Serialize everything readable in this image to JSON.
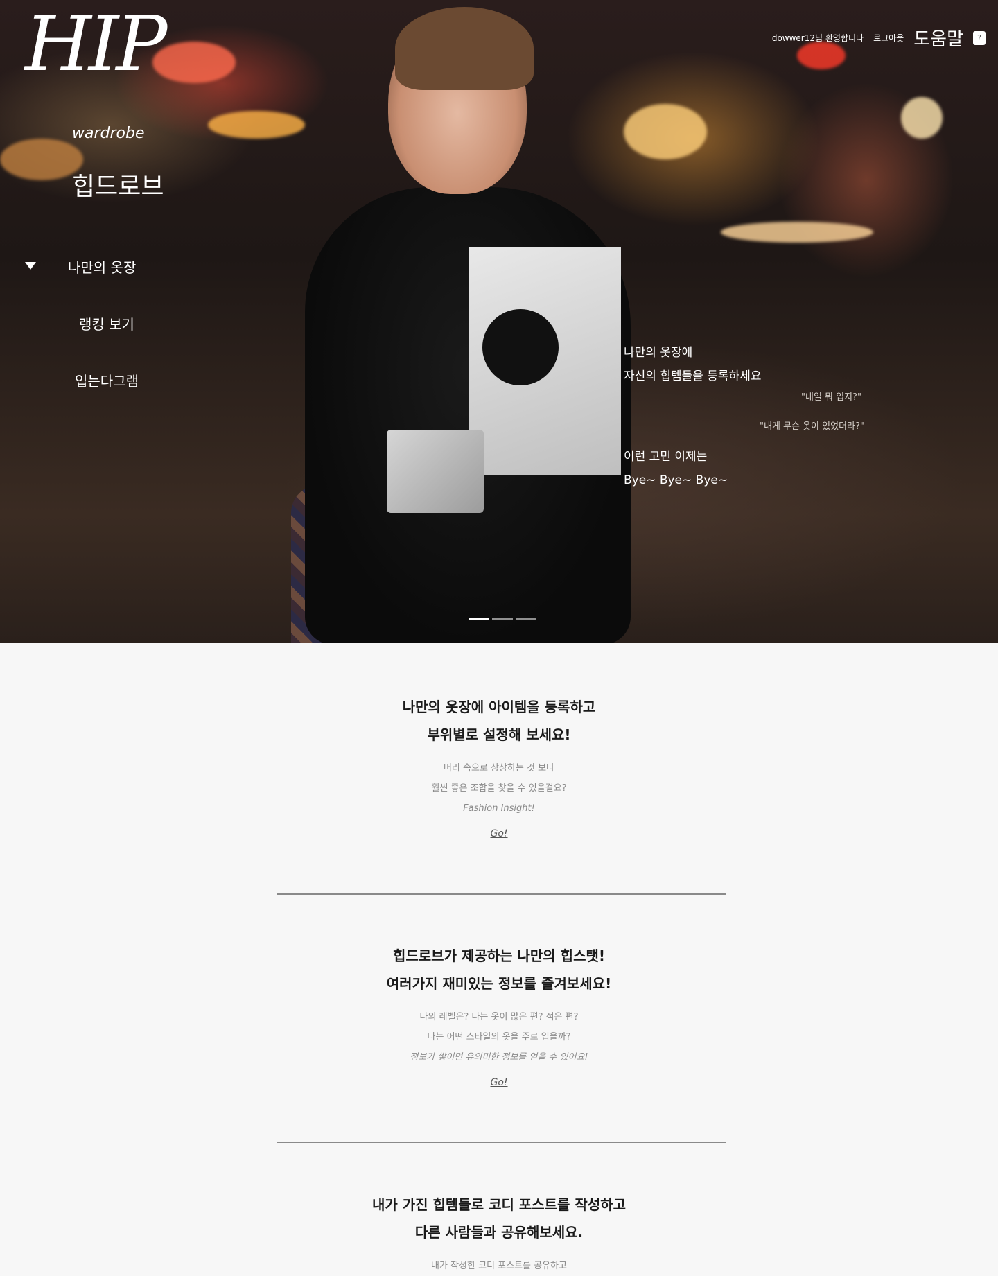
{
  "brand": {
    "logo": "HIP",
    "sub": "wardrobe",
    "kr": "힙드로브"
  },
  "top_nav": {
    "welcome": "dowwer12님 환영합니다",
    "logout": "로그아웃",
    "help": "도움말",
    "help_icon": "?"
  },
  "side_nav": {
    "items": [
      {
        "label": "나만의 옷장"
      },
      {
        "label": "랭킹 보기"
      },
      {
        "label": "입는다그램"
      }
    ]
  },
  "hero": {
    "line1": "나만의 옷장에",
    "line2": "자신의 힙템들을 등록하세요",
    "quote1": "\"내일 뭐 입지?\"",
    "quote2": "\"내게 무슨 옷이 있었더라?\"",
    "line3": "이런 고민 이제는",
    "line4": "Bye~ Bye~ Bye~",
    "slides": 3,
    "active_slide": 1
  },
  "sections": [
    {
      "title1": "나만의 옷장에 아이템을 등록하고",
      "title2": "부위별로 설정해 보세요!",
      "desc1": "머리 속으로 상상하는 것 보다",
      "desc2": "훨씬 좋은 조합을 찾을 수 있을걸요?",
      "desc3": "Fashion Insight!",
      "go": "Go!"
    },
    {
      "title1": "힙드로브가 제공하는 나만의 힙스탯!",
      "title2": "여러가지 재미있는 정보를 즐겨보세요!",
      "desc1": "나의 레벨은? 나는 옷이 많은 편? 적은 편?",
      "desc2": "나는 어떤 스타일의 옷을 주로 입을까?",
      "desc3": "정보가 쌓이면 유의미한 정보를 얻을 수 있어요!",
      "go": "Go!"
    },
    {
      "title1": "내가 가진 힙템들로 코디 포스트를 작성하고",
      "title2": "다른 사람들과 공유해보세요.",
      "desc1": "내가 작성한 코디 포스트를 공유하고"
    }
  ],
  "colors": {
    "page_bg": "#f7f7f7",
    "divider": "#8a8a8a",
    "title": "#1a1a1a",
    "desc": "#8a8a8a"
  }
}
